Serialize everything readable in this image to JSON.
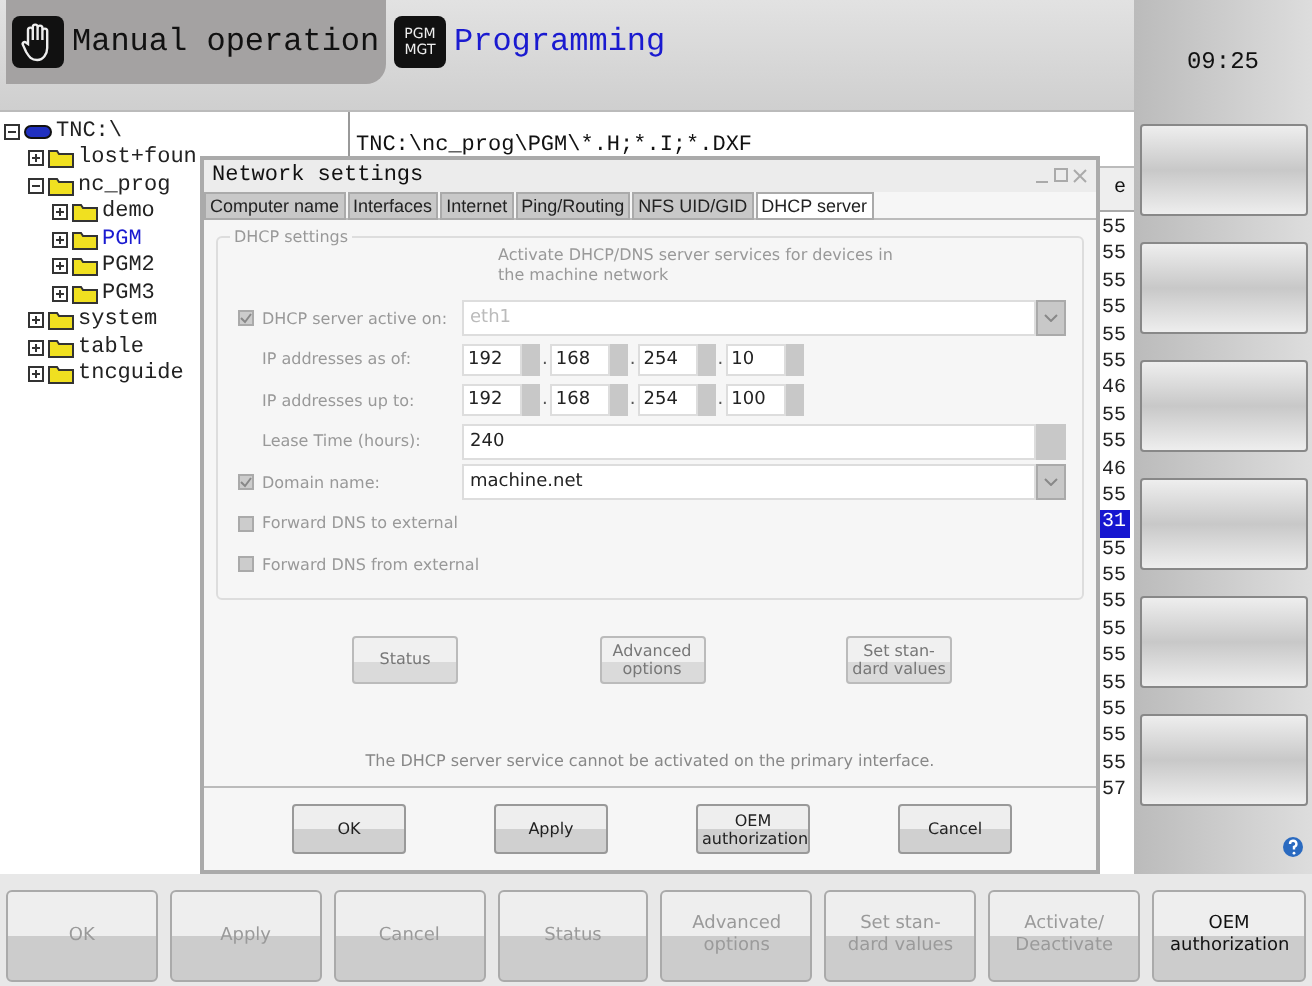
{
  "header": {
    "mode": "Manual operation",
    "pgm_key": "PGM MGT",
    "app": "Programming",
    "clock": "09:25"
  },
  "tree": [
    {
      "label": "TNC:\\",
      "kind": "drive",
      "expanded": true,
      "selected": false,
      "children": [
        {
          "label": "lost+foun",
          "kind": "folder",
          "expanded": false,
          "selected": false
        },
        {
          "label": "nc_prog",
          "kind": "folder",
          "expanded": true,
          "selected": false,
          "children": [
            {
              "label": "demo",
              "kind": "folder",
              "expanded": false,
              "selected": false
            },
            {
              "label": "PGM",
              "kind": "folder",
              "expanded": false,
              "selected": true
            },
            {
              "label": "PGM2",
              "kind": "folder",
              "expanded": false,
              "selected": false
            },
            {
              "label": "PGM3",
              "kind": "folder",
              "expanded": false,
              "selected": false
            }
          ]
        },
        {
          "label": "system",
          "kind": "folder",
          "expanded": false,
          "selected": false
        },
        {
          "label": "table",
          "kind": "folder",
          "expanded": false,
          "selected": false
        },
        {
          "label": "tncguide",
          "kind": "folder",
          "expanded": false,
          "selected": false
        }
      ]
    }
  ],
  "file_panel": {
    "path": "TNC:\\nc_prog\\PGM\\*.H;*.I;*.DXF",
    "column_header": "e",
    "cells": [
      {
        "text": "55",
        "selected": false
      },
      {
        "text": "55",
        "selected": false
      },
      {
        "text": "55",
        "selected": false
      },
      {
        "text": "55",
        "selected": false
      },
      {
        "text": "55",
        "selected": false
      },
      {
        "text": "55",
        "selected": false
      },
      {
        "text": "46",
        "selected": false
      },
      {
        "text": "55",
        "selected": false
      },
      {
        "text": "55",
        "selected": false
      },
      {
        "text": "46",
        "selected": false
      },
      {
        "text": "55",
        "selected": false
      },
      {
        "text": "31",
        "selected": true
      },
      {
        "text": "55",
        "selected": false
      },
      {
        "text": "55",
        "selected": false
      },
      {
        "text": "55",
        "selected": false
      },
      {
        "text": "55",
        "selected": false
      },
      {
        "text": "55",
        "selected": false
      },
      {
        "text": "55",
        "selected": false
      },
      {
        "text": "55",
        "selected": false
      },
      {
        "text": "55",
        "selected": false
      },
      {
        "text": "55",
        "selected": false
      },
      {
        "text": "57",
        "selected": false
      }
    ]
  },
  "dialog": {
    "title": "Network settings",
    "tabs": [
      {
        "label": "Computer name",
        "selected": false
      },
      {
        "label": "Interfaces",
        "selected": false
      },
      {
        "label": "Internet",
        "selected": false
      },
      {
        "label": "Ping/Routing",
        "selected": false
      },
      {
        "label": "NFS UID/GID",
        "selected": false
      },
      {
        "label": "DHCP server",
        "selected": true
      }
    ],
    "group": "DHCP settings",
    "hint": "Activate DHCP/DNS server services for devices in the machine network",
    "rows": [
      {
        "kind": "combo",
        "label": "DHCP server active on:",
        "checkbox": true,
        "checked": true,
        "value": "eth1",
        "disabled": true
      },
      {
        "kind": "ip",
        "label": "IP addresses as of:",
        "separator": ".",
        "octets": [
          "192",
          "168",
          "254",
          "10"
        ]
      },
      {
        "kind": "ip",
        "label": "IP addresses up to:",
        "separator": ".",
        "octets": [
          "192",
          "168",
          "254",
          "100"
        ]
      },
      {
        "kind": "spin",
        "label": "Lease Time (hours):",
        "value": "240"
      },
      {
        "kind": "combo",
        "label": "Domain name:",
        "checkbox": true,
        "checked": true,
        "value": "machine.net",
        "disabled": false
      },
      {
        "kind": "check",
        "label": "Forward DNS to external",
        "checked": false
      },
      {
        "kind": "check",
        "label": "Forward DNS from external",
        "checked": false
      }
    ],
    "actions": [
      {
        "label": "Status",
        "disabled": true
      },
      {
        "label": "Advanced options",
        "disabled": true
      },
      {
        "label": "Set stan-dard values",
        "disabled": true
      }
    ],
    "message": "The DHCP server service cannot be activated on the primary interface.",
    "buttons": [
      {
        "label": "OK"
      },
      {
        "label": "Apply"
      },
      {
        "label": "OEM authorization"
      },
      {
        "label": "Cancel"
      }
    ]
  },
  "softkeys": [
    {
      "label": "OK",
      "disabled": true
    },
    {
      "label": "Apply",
      "disabled": true
    },
    {
      "label": "Cancel",
      "disabled": true
    },
    {
      "label": "Status",
      "disabled": true
    },
    {
      "label": "Advanced options",
      "disabled": true
    },
    {
      "label": "Set stan-dard values",
      "disabled": true
    },
    {
      "label": "Activate/ Deactivate",
      "disabled": true
    },
    {
      "label": "OEM authorization",
      "disabled": false
    }
  ]
}
